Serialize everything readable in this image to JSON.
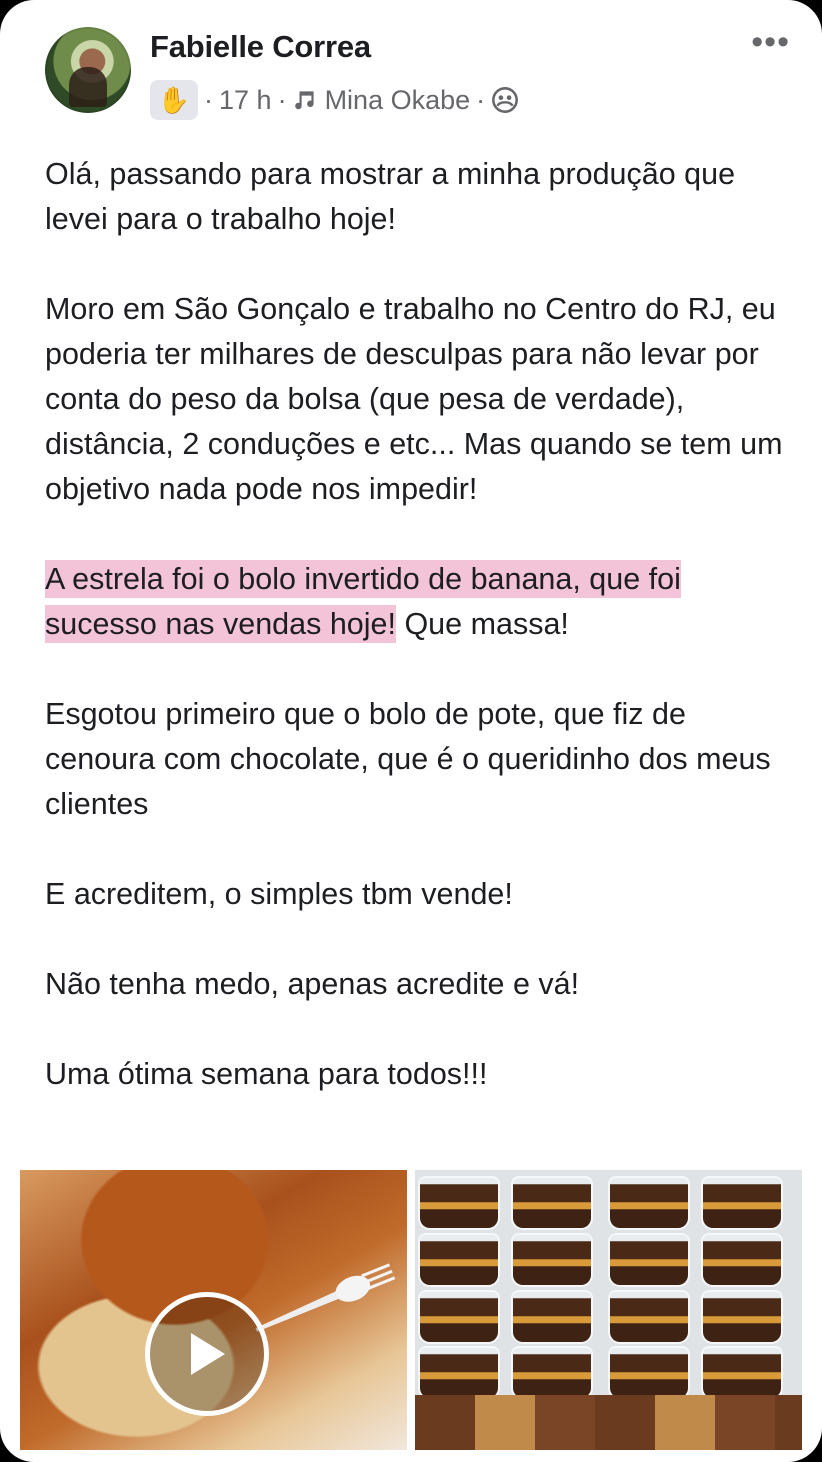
{
  "post": {
    "author": "Fabielle Correa",
    "time": "17 h",
    "music": "Mina Okabe",
    "more_label": "•••",
    "paragraphs": {
      "p1": "Olá, passando para mostrar a minha produção que levei para o trabalho hoje!",
      "p2": "Moro em São Gonçalo e trabalho no Centro do RJ, eu poderia ter milhares de desculpas para não levar por conta do peso da bolsa (que pesa de verdade), distância, 2 conduções e etc... Mas quando se tem um objetivo nada pode nos impedir!",
      "p3_highlight": "A estrela foi o bolo invertido de banana, que foi sucesso nas vendas hoje!",
      "p3_rest": " Que massa!",
      "p4": "Esgotou primeiro que o bolo de pote, que fiz  de cenoura com chocolate, que é o queridinho dos meus clientes",
      "p5": "E acreditem, o simples tbm vende!",
      "p6": "Não tenha medo, apenas acredite e vá!",
      "p7": "Uma ótima semana para todos!!!"
    }
  },
  "colors": {
    "highlight": "#f3c3d8",
    "text": "#1c1e21",
    "meta": "#65676b"
  },
  "icons": {
    "wave": "waving-hand-icon",
    "music": "music-note-icon",
    "audience": "friends-audience-icon",
    "play": "play-icon"
  }
}
